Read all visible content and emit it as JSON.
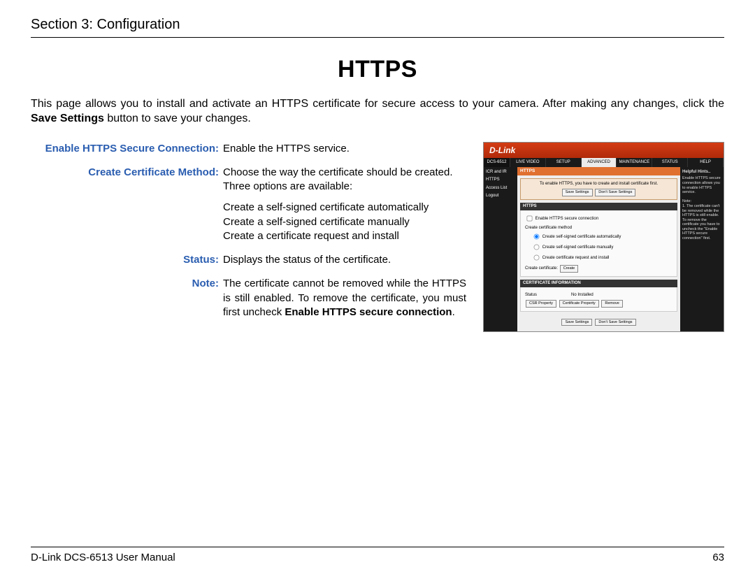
{
  "header": {
    "section": "Section 3: Configuration"
  },
  "title": "HTTPS",
  "intro": {
    "pre": "This page allows you to install and activate an HTTPS certificate for secure access to your camera. After making any changes, click the ",
    "bold": "Save Settings",
    "post": " button to save your changes."
  },
  "defs": {
    "enable": {
      "label": "Enable HTTPS Secure Connection:",
      "body": "Enable the HTTPS service."
    },
    "method": {
      "label": "Create Certificate Method:",
      "lead": "Choose the way the certificate should be created. Three options are available:",
      "opt1": "Create a self-signed certificate automatically",
      "opt2": "Create a self-signed certificate manually",
      "opt3": "Create a certificate request and install"
    },
    "status": {
      "label": "Status:",
      "body": "Displays the status of the certificate."
    },
    "note": {
      "label": "Note:",
      "pre": "The certificate cannot be removed while the HTTPS is still enabled. To remove the certificate, you must first uncheck ",
      "bold": "Enable HTTPS secure connection",
      "post": "."
    }
  },
  "screenshot": {
    "brand": "D-Link",
    "model": "DCS-6512",
    "tabs": [
      "LIVE VIDEO",
      "SETUP",
      "ADVANCED",
      "MAINTENANCE",
      "STATUS",
      "HELP"
    ],
    "active_tab_index": 2,
    "nav": [
      "ICR and IR",
      "HTTPS",
      "Access List",
      "Logout"
    ],
    "banner_title": "HTTPS",
    "notice": "To enable HTTPS, you have to create and install certificate first.",
    "save_btn": "Save Settings",
    "dont_save_btn": "Don't Save Settings",
    "https_section": "HTTPS",
    "enable_chk": "Enable HTTPS secure connection",
    "method_heading": "Create certificate method",
    "r1": "Create self-signed certificate automatically",
    "r2": "Create self-signed certificate manually",
    "r3": "Create certificate request and install",
    "create_label": "Create certificate:",
    "create_btn": "Create",
    "cert_info_bar": "CERTIFICATE INFORMATION",
    "cert_status_k": "Status",
    "cert_status_v": "No Installed",
    "cert_btn1": "CSR Property",
    "cert_btn2": "Certificate Property",
    "cert_btn3": "Remove",
    "help_title": "Helpful Hints..",
    "help_lead": "Enable HTTPS secure connection",
    "help_body1": "allows you to enable HTTPS service.",
    "help_note": "Note:",
    "help_body2": "1. The certificate can't be removed while the HTTPS is still enable. To remove the certificate you have to uncheck the \"Enable HTTPS secure connection\" first."
  },
  "footer": {
    "left": "D-Link DCS-6513 User Manual",
    "right": "63"
  }
}
